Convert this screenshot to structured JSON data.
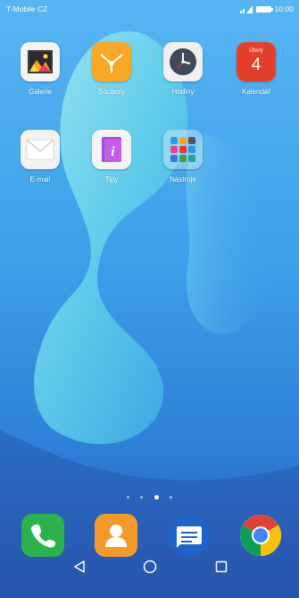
{
  "status_bar": {
    "carrier": "T-Mobile CZ",
    "time": "10:00",
    "icons": [
      "signal-icon",
      "battery-icon"
    ]
  },
  "home_screen": {
    "apps_row1": [
      {
        "label": "Galerie",
        "icon": "gallery-icon"
      },
      {
        "label": "Soubory",
        "icon": "files-icon"
      },
      {
        "label": "Hodiny",
        "icon": "clock-icon"
      },
      {
        "label": "Kalendář",
        "icon": "calendar-icon",
        "day_short": "Úterý",
        "day_num": "4"
      }
    ],
    "apps_row2": [
      {
        "label": "E-mail",
        "icon": "email-icon"
      },
      {
        "label": "Tipy",
        "icon": "tips-icon"
      },
      {
        "label": "Nástroje",
        "icon": "tools-folder-icon"
      }
    ],
    "page_indicator": {
      "pages": 4,
      "current": 3
    }
  },
  "dock": [
    {
      "icon": "phone-icon",
      "color": "#2bb24c"
    },
    {
      "icon": "contacts-icon",
      "color": "#f39a2b"
    },
    {
      "icon": "messages-icon",
      "color": "#1e63c8"
    },
    {
      "icon": "chrome-icon",
      "color": "#ffffff"
    }
  ],
  "nav_bar": [
    "back-icon",
    "home-icon",
    "recents-icon"
  ],
  "colors": {
    "wallpaper_top": "#58b4f2",
    "wallpaper_mid": "#3aa0e8",
    "wallpaper_bottom": "#2a5fb8",
    "wave_cyan": "#5fd6e8"
  }
}
